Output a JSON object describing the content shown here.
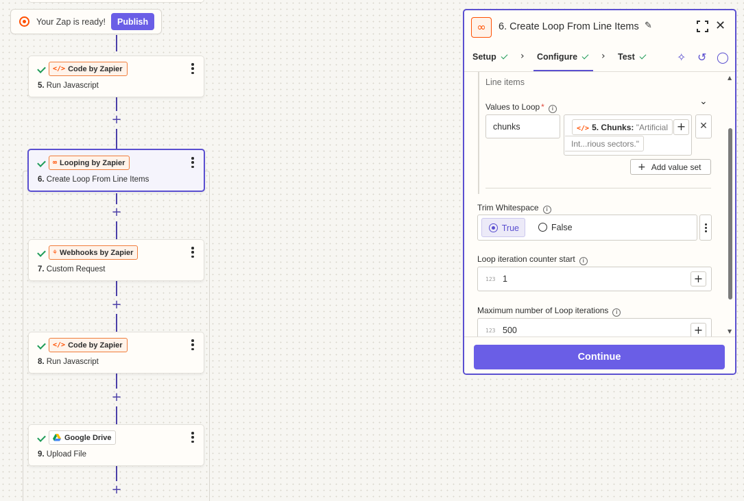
{
  "canvas": {
    "banner": {
      "text": "Your Zap is ready!",
      "publish_label": "Publish"
    },
    "steps": [
      {
        "app": "Code by Zapier",
        "app_icon": "code-icon",
        "number": "5.",
        "title": "Run Javascript",
        "status": "complete"
      },
      {
        "app": "Looping by Zapier",
        "app_icon": "loop-icon",
        "number": "6.",
        "title": "Create Loop From Line Items",
        "status": "complete",
        "selected": true
      },
      {
        "app": "Webhooks by Zapier",
        "app_icon": "webhook-icon",
        "number": "7.",
        "title": "Custom Request",
        "status": "complete"
      },
      {
        "app": "Code by Zapier",
        "app_icon": "code-icon",
        "number": "8.",
        "title": "Run Javascript",
        "status": "complete"
      },
      {
        "app": "Google Drive",
        "app_icon": "google-drive-icon",
        "number": "9.",
        "title": "Upload File",
        "status": "complete"
      }
    ],
    "add_step_symbol": "+"
  },
  "panel": {
    "title": "6. Create Loop From Line Items",
    "tabs": [
      {
        "label": "Setup",
        "complete": true
      },
      {
        "label": "Configure",
        "complete": true,
        "active": true
      },
      {
        "label": "Test",
        "complete": true
      }
    ],
    "section_label": "Line items",
    "values_to_loop": {
      "label": "Values to Loop",
      "required_mark": "*",
      "key": "chunks",
      "value_step": "5. Chunks:",
      "value_preview_1": "\"Artificial",
      "value_preview_2": "Int...rious sectors.\""
    },
    "add_value_set_label": "Add value set",
    "trim_whitespace": {
      "label": "Trim Whitespace",
      "options": [
        "True",
        "False"
      ],
      "selected": "True"
    },
    "counter_start": {
      "label": "Loop iteration counter start",
      "type_tag": "123",
      "value": "1"
    },
    "max_iterations": {
      "label": "Maximum number of Loop iterations",
      "type_tag": "123",
      "value": "500"
    },
    "continue_label": "Continue"
  },
  "colors": {
    "accent": "#6a5ee6",
    "selected_border": "#5a4fd0",
    "brand_orange": "#ff4f00",
    "success_green": "#1e9b57"
  }
}
